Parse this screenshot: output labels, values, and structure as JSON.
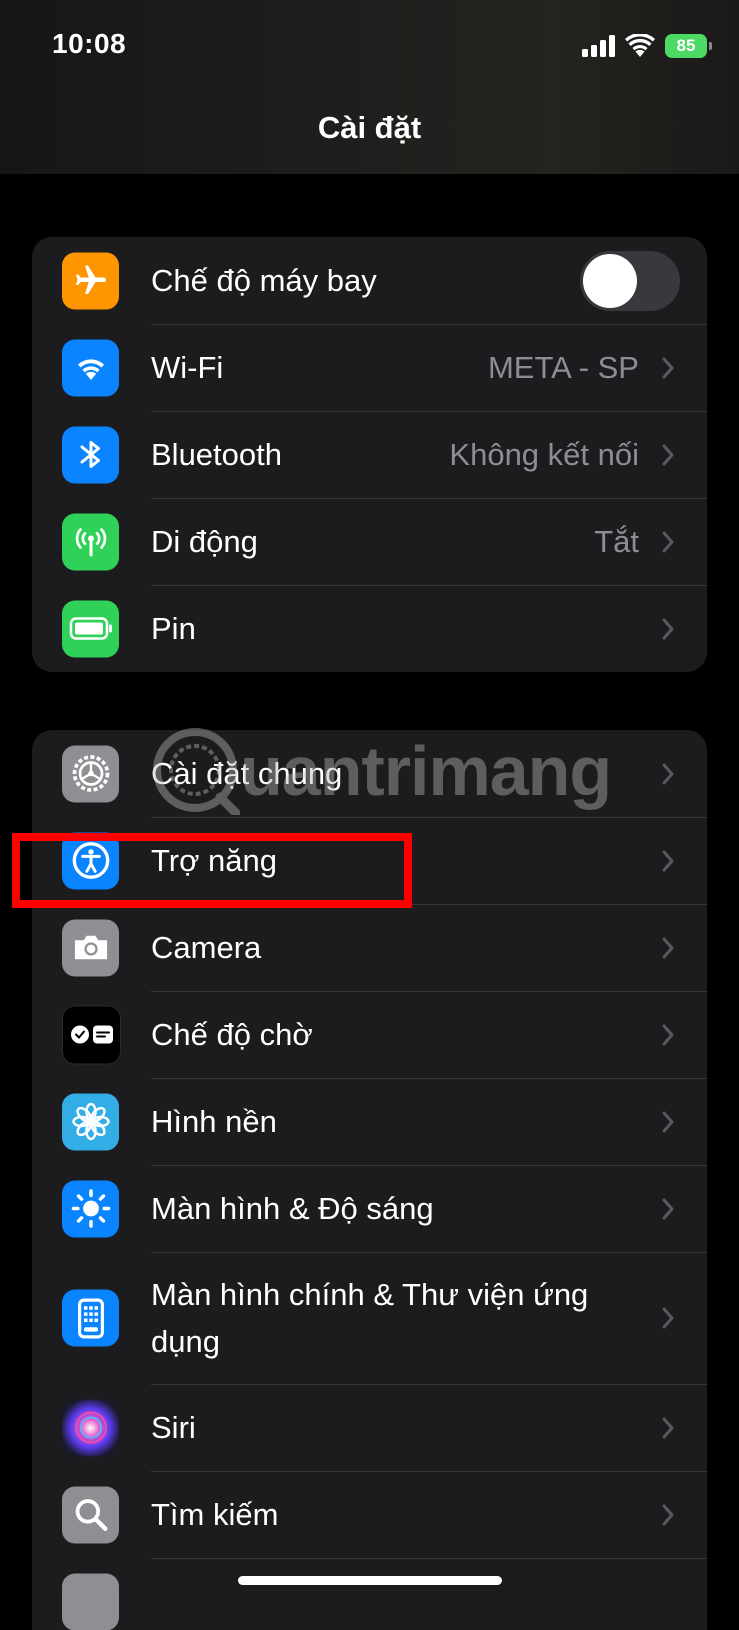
{
  "status": {
    "time": "10:08",
    "battery": "85"
  },
  "header": {
    "title": "Cài đặt"
  },
  "group1": [
    {
      "id": "airplane",
      "label": "Chế độ máy bay",
      "icon": "airplane-icon",
      "color": "#ff9500",
      "toggle": false
    },
    {
      "id": "wifi",
      "label": "Wi-Fi",
      "value": "META - SP",
      "icon": "wifi-icon",
      "color": "#0a84ff"
    },
    {
      "id": "bluetooth",
      "label": "Bluetooth",
      "value": "Không kết nối",
      "icon": "bluetooth-icon",
      "color": "#0a84ff"
    },
    {
      "id": "cellular",
      "label": "Di động",
      "value": "Tắt",
      "icon": "antenna-icon",
      "color": "#30d158"
    },
    {
      "id": "battery",
      "label": "Pin",
      "icon": "battery-icon",
      "color": "#30d158"
    }
  ],
  "group2": [
    {
      "id": "general",
      "label": "Cài đặt chung",
      "icon": "gear-icon",
      "color": "#8e8e93"
    },
    {
      "id": "accessibility",
      "label": "Trợ năng",
      "icon": "accessibility-icon",
      "color": "#0a84ff"
    },
    {
      "id": "camera",
      "label": "Camera",
      "icon": "camera-icon",
      "color": "#8e8e93"
    },
    {
      "id": "standby",
      "label": "Chế độ chờ",
      "icon": "standby-icon",
      "color": "#000000"
    },
    {
      "id": "wallpaper",
      "label": "Hình nền",
      "icon": "flower-icon",
      "color": "#32ade6"
    },
    {
      "id": "display",
      "label": "Màn hình & Độ sáng",
      "icon": "sun-icon",
      "color": "#0a84ff"
    },
    {
      "id": "homescreen",
      "label": "Màn hình chính & Thư viện ứng dụng",
      "icon": "phone-grid-icon",
      "color": "#0a84ff"
    },
    {
      "id": "siri",
      "label": "Siri",
      "icon": "siri-icon",
      "color": "#1c1c1e"
    },
    {
      "id": "search",
      "label": "Tìm kiếm",
      "icon": "search-icon",
      "color": "#8e8e93"
    }
  ],
  "watermark": {
    "text": "uantrimang"
  }
}
